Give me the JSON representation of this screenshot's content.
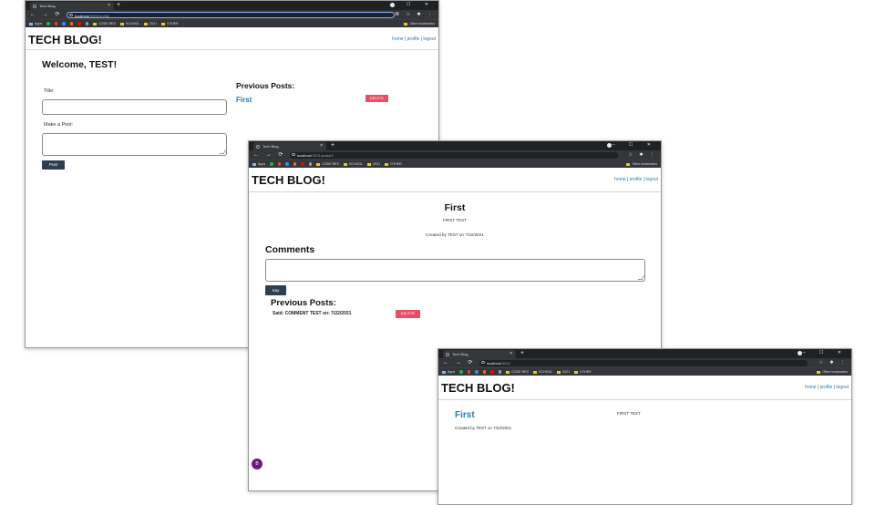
{
  "browser": {
    "tab_title": "Tech Blog",
    "new_tab": "+",
    "window_controls": "– ☐ ✕",
    "apps_label": "Apps",
    "other_bookmarks": "Other bookmarks",
    "bookmarks": [
      "CODE RES",
      "SCHOOL",
      "2021",
      "OTHER"
    ]
  },
  "site": {
    "brand": "TECH BLOG!",
    "nav": {
      "home": "home",
      "sep": "|",
      "profile": "profile",
      "logout": "logout"
    }
  },
  "window1": {
    "url_host": "localhost",
    "url_rest": ":3001/profile",
    "welcome": "Welcome, TEST!",
    "title_label": "Title:",
    "post_label": "Make a Post:",
    "post_button": "Post",
    "previous_posts_heading": "Previous Posts:",
    "post_link": "First",
    "delete_button": "DELETE"
  },
  "window2": {
    "url_host": "localhost",
    "url_rest": ":3001/posts/1",
    "post_title": "First",
    "post_body": "FIRST TEST",
    "created": "Created by TEST on 7/22/2021",
    "comments_heading": "Comments",
    "say_button": "Say",
    "previous_posts_heading": "Previous Posts:",
    "comment_text": "Said: COMMENT TEST on: 7/22/2021",
    "delete_button": "DELETE",
    "avatar_letter": "B"
  },
  "window3": {
    "url_host": "localhost",
    "url_rest": ":3001",
    "post_link": "First",
    "post_body": "FIRST TEST",
    "created": "Created by TEST on 7/22/2021"
  },
  "colors": {
    "chrome_dark": "#202124",
    "link_blue": "#2a7bb0",
    "delete_red": "#e8506a",
    "button_dark": "#2c3e50",
    "avatar_purple": "#6a1b7a"
  }
}
